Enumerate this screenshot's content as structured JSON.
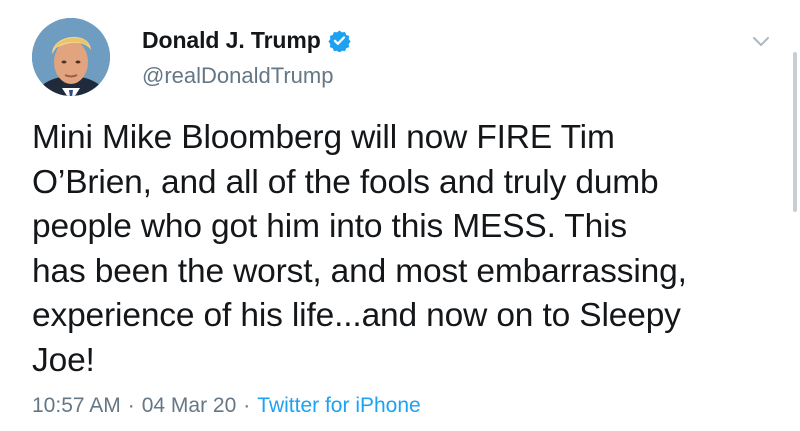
{
  "user": {
    "display_name": "Donald J. Trump",
    "handle": "@realDonaldTrump",
    "verified": true
  },
  "tweet": {
    "text": "Mini Mike Bloomberg will now FIRE Tim\nO’Brien, and all of the fools and truly dumb\npeople who got him into this MESS. This\nhas been the worst, and most embarrassing,\nexperience of his life...and now on to Sleepy\nJoe!",
    "time": "10:57 AM",
    "date": "04 Mar 20",
    "source": "Twitter for iPhone",
    "separator": "·"
  },
  "icons": {
    "verified": "verified-badge-icon",
    "menu": "chevron-down-icon"
  },
  "colors": {
    "text": "#14171a",
    "secondary": "#657786",
    "link": "#1da1f2",
    "verified": "#1da1f2"
  }
}
